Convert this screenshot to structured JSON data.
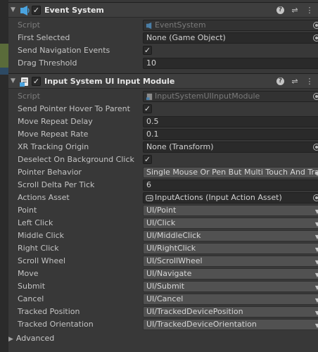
{
  "event_system": {
    "title": "Event System",
    "enabled_mark": "✓",
    "rows": {
      "script": {
        "label": "Script",
        "value": "EventSystem"
      },
      "first_selected": {
        "label": "First Selected",
        "value": "None (Game Object)"
      },
      "send_navigation": {
        "label": "Send Navigation Events",
        "value": "✓"
      },
      "drag_threshold": {
        "label": "Drag Threshold",
        "value": "10"
      }
    }
  },
  "input_module": {
    "title": "Input System UI Input Module",
    "enabled_mark": "✓",
    "rows": {
      "script": {
        "label": "Script",
        "value": "InputSystemUIInputModule"
      },
      "send_pointer_hover": {
        "label": "Send Pointer Hover To Parent",
        "value": "✓"
      },
      "move_repeat_delay": {
        "label": "Move Repeat Delay",
        "value": "0.5"
      },
      "move_repeat_rate": {
        "label": "Move Repeat Rate",
        "value": "0.1"
      },
      "xr_tracking_origin": {
        "label": "XR Tracking Origin",
        "value": "None (Transform)"
      },
      "deselect_on_bg": {
        "label": "Deselect On Background Click",
        "value": "✓"
      },
      "pointer_behavior": {
        "label": "Pointer Behavior",
        "value": "Single Mouse Or Pen But Multi Touch And Track"
      },
      "scroll_delta": {
        "label": "Scroll Delta Per Tick",
        "value": "6"
      },
      "actions_asset": {
        "label": "Actions Asset",
        "value": "InputActions (Input Action Asset)"
      },
      "point": {
        "label": "Point",
        "value": "UI/Point"
      },
      "left_click": {
        "label": "Left Click",
        "value": "UI/Click"
      },
      "middle_click": {
        "label": "Middle Click",
        "value": "UI/MiddleClick"
      },
      "right_click": {
        "label": "Right Click",
        "value": "UI/RightClick"
      },
      "scroll_wheel": {
        "label": "Scroll Wheel",
        "value": "UI/ScrollWheel"
      },
      "move": {
        "label": "Move",
        "value": "UI/Navigate"
      },
      "submit": {
        "label": "Submit",
        "value": "UI/Submit"
      },
      "cancel": {
        "label": "Cancel",
        "value": "UI/Cancel"
      },
      "tracked_position": {
        "label": "Tracked Position",
        "value": "UI/TrackedDevicePosition"
      },
      "tracked_orientation": {
        "label": "Tracked Orientation",
        "value": "UI/TrackedDeviceOrientation"
      }
    },
    "advanced": "Advanced"
  },
  "icons": {
    "help": "?",
    "presets": "⇌",
    "menu": "⋮",
    "fold_open": "▼",
    "fold_closed": "▶",
    "dropdown": "▼"
  },
  "colors": {
    "panel_bg": "#383838",
    "header_bg": "#3e3e3e",
    "field_bg": "#2a2a2a",
    "dropdown_bg": "#515151",
    "accent_blue": "#4aa3df"
  }
}
